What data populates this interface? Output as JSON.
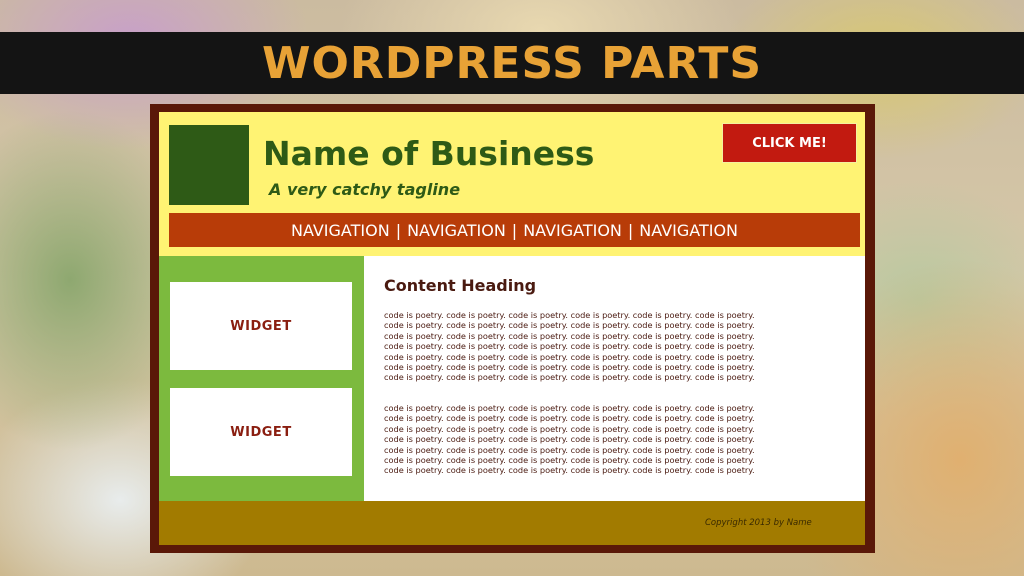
{
  "banner": {
    "title": "WORDPRESS PARTS"
  },
  "header": {
    "business_name": "Name of Business",
    "tagline": "A very catchy tagline",
    "cta_label": "CLICK ME!"
  },
  "nav": {
    "items": [
      "NAVIGATION",
      "NAVIGATION",
      "NAVIGATION",
      "NAVIGATION"
    ],
    "separator": "|"
  },
  "sidebar": {
    "widgets": [
      "WIDGET",
      "WIDGET"
    ]
  },
  "content": {
    "heading": "Content Heading",
    "paragraphs": [
      [
        "code is poetry. code is poetry. code is poetry. code is poetry. code is poetry. code is poetry.",
        "code is poetry. code is poetry. code is poetry. code is poetry. code is poetry. code is poetry.",
        "code is poetry. code is poetry. code is poetry. code is poetry. code is poetry. code is poetry.",
        "code is poetry. code is poetry. code is poetry. code is poetry. code is poetry. code is poetry.",
        "code is poetry. code is poetry. code is poetry. code is poetry. code is poetry. code is poetry.",
        "code is poetry. code is poetry. code is poetry. code is poetry. code is poetry. code is poetry.",
        "code is poetry. code is poetry. code is poetry. code is poetry. code is poetry. code is poetry."
      ],
      [
        "code is poetry. code is poetry. code is poetry. code is poetry. code is poetry. code is poetry.",
        "code is poetry. code is poetry. code is poetry. code is poetry. code is poetry. code is poetry.",
        "code is poetry. code is poetry. code is poetry. code is poetry. code is poetry. code is poetry.",
        "code is poetry. code is poetry. code is poetry. code is poetry. code is poetry. code is poetry.",
        "code is poetry. code is poetry. code is poetry. code is poetry. code is poetry. code is poetry.",
        "code is poetry. code is poetry. code is poetry. code is poetry. code is poetry. code is poetry.",
        "code is poetry. code is poetry. code is poetry. code is poetry. code is poetry. code is poetry."
      ]
    ]
  },
  "footer": {
    "copyright": "Copyright 2013 by Name"
  },
  "colors": {
    "banner_text": "#e8a236",
    "header_bg": "#fff373",
    "logo": "#2e5a16",
    "cta_bg": "#c21a10",
    "nav_bg": "#b83c08",
    "sidebar_bg": "#7cba3e",
    "footer_bg": "#a27b00",
    "frame": "#5a1808"
  }
}
